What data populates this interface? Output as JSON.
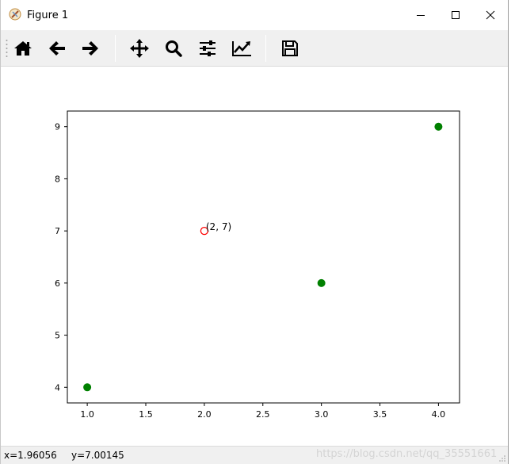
{
  "window": {
    "title": "Figure 1"
  },
  "toolbar": {
    "buttons": [
      {
        "icon": "home-icon"
      },
      {
        "icon": "back-arrow-icon"
      },
      {
        "icon": "forward-arrow-icon"
      },
      {
        "icon": "pan-move-icon"
      },
      {
        "icon": "zoom-magnifier-icon"
      },
      {
        "icon": "configure-subplots-icon"
      },
      {
        "icon": "edit-axis-curve-icon"
      },
      {
        "icon": "save-disk-icon"
      }
    ]
  },
  "status": {
    "x_readout": "x=1.96056",
    "y_readout": "y=7.00145",
    "watermark": "https://blog.csdn.net/qq_35551661"
  },
  "colors": {
    "point_fill": "#008000",
    "highlight_edge": "#ff0000",
    "toolbar_bg": "#f0f0f0"
  },
  "chart_data": {
    "type": "scatter",
    "title": "",
    "xlabel": "",
    "ylabel": "",
    "xlim": [
      0.83,
      4.18
    ],
    "ylim": [
      3.7,
      9.3
    ],
    "xticks": [
      1.0,
      1.5,
      2.0,
      2.5,
      3.0,
      3.5,
      4.0
    ],
    "xtick_labels": [
      "1.0",
      "1.5",
      "2.0",
      "2.5",
      "3.0",
      "3.5",
      "4.0"
    ],
    "yticks": [
      4,
      5,
      6,
      7,
      8,
      9
    ],
    "ytick_labels": [
      "4",
      "5",
      "6",
      "7",
      "8",
      "9"
    ],
    "grid": false,
    "series": [
      {
        "x": [
          1,
          2,
          3,
          4
        ],
        "y": [
          4,
          7,
          6,
          9
        ],
        "color": "#008000"
      }
    ],
    "highlighted_point": {
      "x": 2,
      "y": 7,
      "edgecolor": "#ff0000"
    },
    "annotation": {
      "text": "(2, 7)",
      "x": 2,
      "y": 7
    }
  }
}
